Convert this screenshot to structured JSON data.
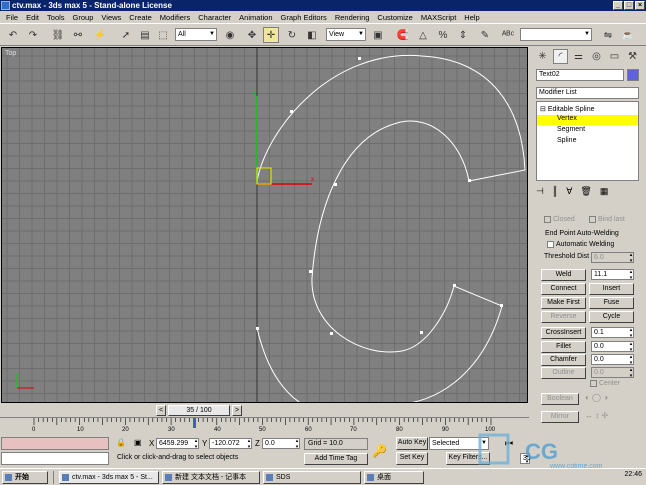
{
  "window": {
    "title": "ctv.max - 3ds max 5 - Stand-alone License",
    "min": "_",
    "max": "□",
    "close": "×"
  },
  "menu": [
    "File",
    "Edit",
    "Tools",
    "Group",
    "Views",
    "Create",
    "Modifiers",
    "Character",
    "Animation",
    "Graph Editors",
    "Rendering",
    "Customize",
    "MAXScript",
    "Help"
  ],
  "toolbar": {
    "selection_filter": "All",
    "ref_coord": "View"
  },
  "viewport": {
    "label": "Top",
    "bg": "#808080",
    "grid": "#6e6e6e",
    "spline": "#ffffff"
  },
  "panel": {
    "object_name": "Text02",
    "object_color": "#6060e0",
    "modifier_list": "Modifier List",
    "stack": [
      "Editable Spline",
      "Vertex",
      "Segment",
      "Spline"
    ],
    "closed": "Closed",
    "bind_last": "Bind last",
    "weld_group": "End Point Auto-Welding",
    "auto_weld": "Automatic Welding",
    "threshold_label": "Threshold Dist",
    "threshold_value": "6.0",
    "weld": "Weld",
    "weld_value": "11.1",
    "connect": "Connect",
    "insert": "Insert",
    "make_first": "Make First",
    "fuse": "Fuse",
    "reverse": "Reverse",
    "cycle": "Cycle",
    "cross_insert": "CrossInsert",
    "cross_value": "0.1",
    "fillet": "Fillet",
    "fillet_value": "0.0",
    "chamfer": "Chamfer",
    "chamfer_value": "0.0",
    "outline": "Outline",
    "outline_value": "0.0",
    "center": "Center",
    "boolean": "Boolean",
    "mirror": "Mirror"
  },
  "timeline": {
    "frame": "35 / 100",
    "prev": "<",
    "next": ">",
    "ticks": [
      "0",
      "10",
      "20",
      "30",
      "40",
      "50",
      "60",
      "70",
      "80",
      "90",
      "100"
    ]
  },
  "status": {
    "x_label": "X",
    "x_value": "6459.299",
    "y_label": "Y",
    "y_value": "-120.072",
    "z_label": "Z",
    "z_value": "0.0",
    "grid": "Grid = 10.0",
    "prompt": "Click or click-and-drag to select objects",
    "add_time_tag": "Add Time Tag",
    "auto_key": "Auto Key",
    "set_key": "Set Key",
    "selected": "Selected",
    "key_filters": "Key Filters...",
    "frame_value": "35"
  },
  "taskbar": {
    "start": "开始",
    "items": [
      "ctv.max - 3ds max 5 - St...",
      "新建 文本文档 - 记事本",
      "SDS",
      "桌面"
    ],
    "clock": "22:46"
  },
  "watermark": {
    "brand": "CG",
    "site": "www.cgtime.com"
  }
}
